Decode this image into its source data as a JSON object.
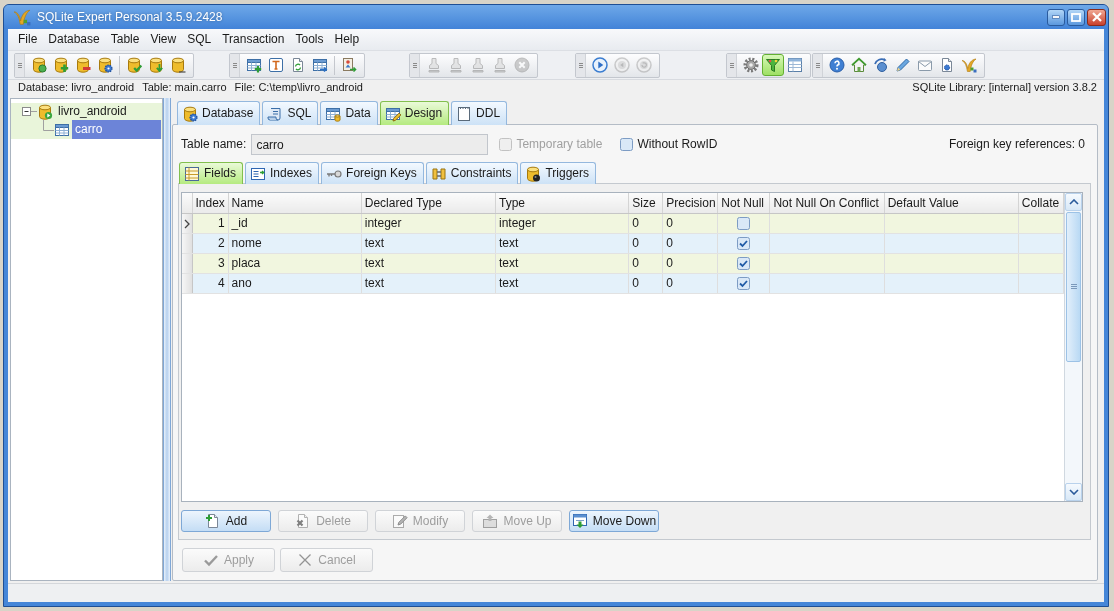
{
  "window": {
    "title": "SQLite Expert Personal 3.5.9.2428"
  },
  "menu": [
    {
      "label": "File"
    },
    {
      "label": "Database"
    },
    {
      "label": "Table"
    },
    {
      "label": "View"
    },
    {
      "label": "SQL"
    },
    {
      "label": "Transaction"
    },
    {
      "label": "Tools"
    },
    {
      "label": "Help"
    }
  ],
  "toolbars": [
    {
      "sections": [
        [
          {
            "disabled": false,
            "pressed": false
          },
          {
            "disabled": false,
            "pressed": false
          },
          {
            "disabled": false,
            "pressed": false
          },
          {
            "disabled": false,
            "pressed": false
          }
        ],
        [
          {
            "disabled": false,
            "pressed": false
          },
          {
            "disabled": false,
            "pressed": false
          },
          {
            "disabled": false,
            "pressed": false
          }
        ]
      ]
    },
    {
      "sections": [
        [
          {
            "disabled": false,
            "pressed": false
          },
          {
            "disabled": false,
            "pressed": false
          },
          {
            "disabled": false,
            "pressed": false
          },
          {
            "disabled": false,
            "pressed": false
          }
        ],
        [
          {
            "disabled": false,
            "pressed": false
          }
        ]
      ]
    },
    {
      "sections": [
        [
          {
            "disabled": true,
            "pressed": false
          },
          {
            "disabled": true,
            "pressed": false
          },
          {
            "disabled": true,
            "pressed": false
          },
          {
            "disabled": true,
            "pressed": false
          },
          {
            "disabled": true,
            "pressed": false
          }
        ]
      ]
    },
    {
      "sections": [
        [
          {
            "disabled": false,
            "pressed": false
          },
          {
            "disabled": true,
            "pressed": false
          },
          {
            "disabled": true,
            "pressed": false
          }
        ]
      ]
    },
    {
      "sections": [
        [
          {
            "disabled": false,
            "pressed": false
          },
          {
            "disabled": false,
            "pressed": true
          },
          {
            "disabled": false,
            "pressed": false
          }
        ]
      ]
    },
    {
      "sections": [
        [
          {
            "disabled": false,
            "pressed": false
          },
          {
            "disabled": false,
            "pressed": false
          },
          {
            "disabled": false,
            "pressed": false
          },
          {
            "disabled": false,
            "pressed": false
          },
          {
            "disabled": false,
            "pressed": false
          },
          {
            "disabled": false,
            "pressed": false
          },
          {
            "disabled": false,
            "pressed": false
          }
        ]
      ]
    }
  ],
  "info_bar": {
    "items": [
      "Database: livro_android",
      "Table: main.carro",
      "File: C:\\temp\\livro_android"
    ],
    "library": "SQLite Library: [internal] version 3.8.2"
  },
  "tree": [
    {
      "kind": "database",
      "label": "livro_android",
      "expanded": true,
      "highlighted": true,
      "selected": false,
      "children": [
        {
          "kind": "table",
          "label": "carro",
          "selected": true
        }
      ]
    }
  ],
  "tabs": [
    {
      "label": "Database",
      "selected": false
    },
    {
      "label": "SQL",
      "selected": false
    },
    {
      "label": "Data",
      "selected": false
    },
    {
      "label": "Design",
      "selected": true
    },
    {
      "label": "DDL",
      "selected": false
    }
  ],
  "table_name": {
    "label": "Table name:",
    "value": "carro"
  },
  "options": [
    {
      "label": "Temporary table",
      "checked": false,
      "disabled": true
    },
    {
      "label": "Without RowID",
      "checked": false,
      "disabled": false
    }
  ],
  "foreign_key_references": "Foreign key references: 0",
  "subtabs": [
    {
      "label": "Fields",
      "selected": true
    },
    {
      "label": "Indexes",
      "selected": false
    },
    {
      "label": "Foreign Keys",
      "selected": false
    },
    {
      "label": "Constraints",
      "selected": false
    },
    {
      "label": "Triggers",
      "selected": false
    }
  ],
  "grid": {
    "columns": [
      "Index",
      "Name",
      "Declared Type",
      "Type",
      "Size",
      "Precision",
      "Not Null",
      "Not Null On Conflict",
      "Default Value",
      "Collate"
    ],
    "rows": [
      {
        "selected": true,
        "index": "1",
        "name": "_id",
        "declared_type": "integer",
        "type": "integer",
        "size": "0",
        "precision": "0",
        "not_null": false
      },
      {
        "selected": false,
        "index": "2",
        "name": "nome",
        "declared_type": "text",
        "type": "text",
        "size": "0",
        "precision": "0",
        "not_null": true
      },
      {
        "selected": false,
        "index": "3",
        "name": "placa",
        "declared_type": "text",
        "type": "text",
        "size": "0",
        "precision": "0",
        "not_null": true
      },
      {
        "selected": false,
        "index": "4",
        "name": "ano",
        "declared_type": "text",
        "type": "text",
        "size": "0",
        "precision": "0",
        "not_null": true
      }
    ]
  },
  "field_buttons": [
    {
      "label": "Add",
      "disabled": false
    },
    {
      "label": "Delete",
      "disabled": true
    },
    {
      "label": "Modify",
      "disabled": true
    },
    {
      "label": "Move Up",
      "disabled": true
    },
    {
      "label": "Move Down",
      "disabled": false
    }
  ],
  "action_buttons": [
    {
      "label": "Apply",
      "disabled": true
    },
    {
      "label": "Cancel",
      "disabled": true
    }
  ]
}
